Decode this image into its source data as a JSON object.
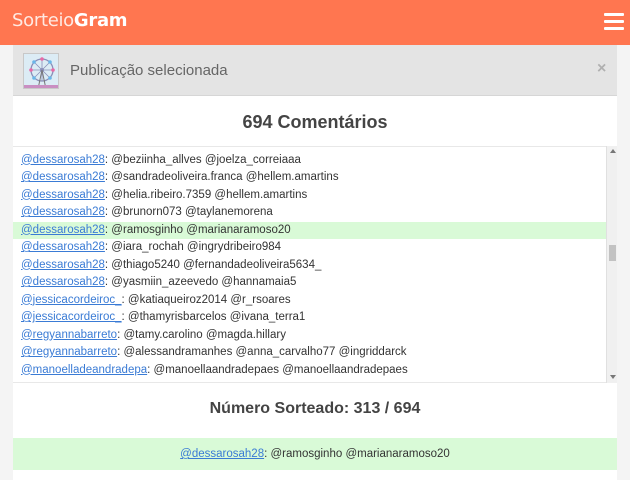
{
  "header": {
    "brand_light": "Sorteio",
    "brand_bold": "Gram"
  },
  "card": {
    "title": "Publicação selecionada",
    "close_label": "×"
  },
  "comments": {
    "title": "694 Comentários",
    "rows": [
      {
        "user": "@dessarosah28",
        "text": ": @beziinha_allves @joelza_correiaaa"
      },
      {
        "user": "@dessarosah28",
        "text": ": @sandradeoliveira.franca @hellem.amartins"
      },
      {
        "user": "@dessarosah28",
        "text": ": @helia.ribeiro.7359 @hellem.amartins"
      },
      {
        "user": "@dessarosah28",
        "text": ": @brunorn073 @taylanemorena"
      },
      {
        "user": "@dessarosah28",
        "text": ": @ramosginho @marianaramoso20",
        "highlight": true
      },
      {
        "user": "@dessarosah28",
        "text": ": @iara_rochah @ingrydribeiro984"
      },
      {
        "user": "@dessarosah28",
        "text": ": @thiago5240 @fernandadeoliveira5634_"
      },
      {
        "user": "@dessarosah28",
        "text": ": @yasmiin_azeevedo @hannamaia5"
      },
      {
        "user": "@jessicacordeiroc_",
        "text": ": @katiaqueiroz2014 @r_rsoares"
      },
      {
        "user": "@jessicacordeiroc_",
        "text": ": @thamyrisbarcelos @ivana_terra1"
      },
      {
        "user": "@regyannabarreto",
        "text": ": @tamy.carolino @magda.hillary"
      },
      {
        "user": "@regyannabarreto",
        "text": ": @alessandramanhes @anna_carvalho77 @ingriddarck"
      },
      {
        "user": "@manoelladeandradepa",
        "text": ": @manoellaandradepaes @manoellaandradepaes"
      }
    ]
  },
  "result": {
    "title": "Número Sorteado: 313 / 694",
    "winner_user": "@dessarosah28",
    "winner_text": ": @ramosginho @marianaramoso20"
  },
  "colors": {
    "topbar": "#ff7650",
    "highlight": "#d9fad7",
    "link": "#3a7bd5"
  },
  "icons": {
    "menu": "hamburger-menu-icon",
    "close": "close-icon",
    "thumbnail": "ferris-wheel-thumbnail"
  }
}
